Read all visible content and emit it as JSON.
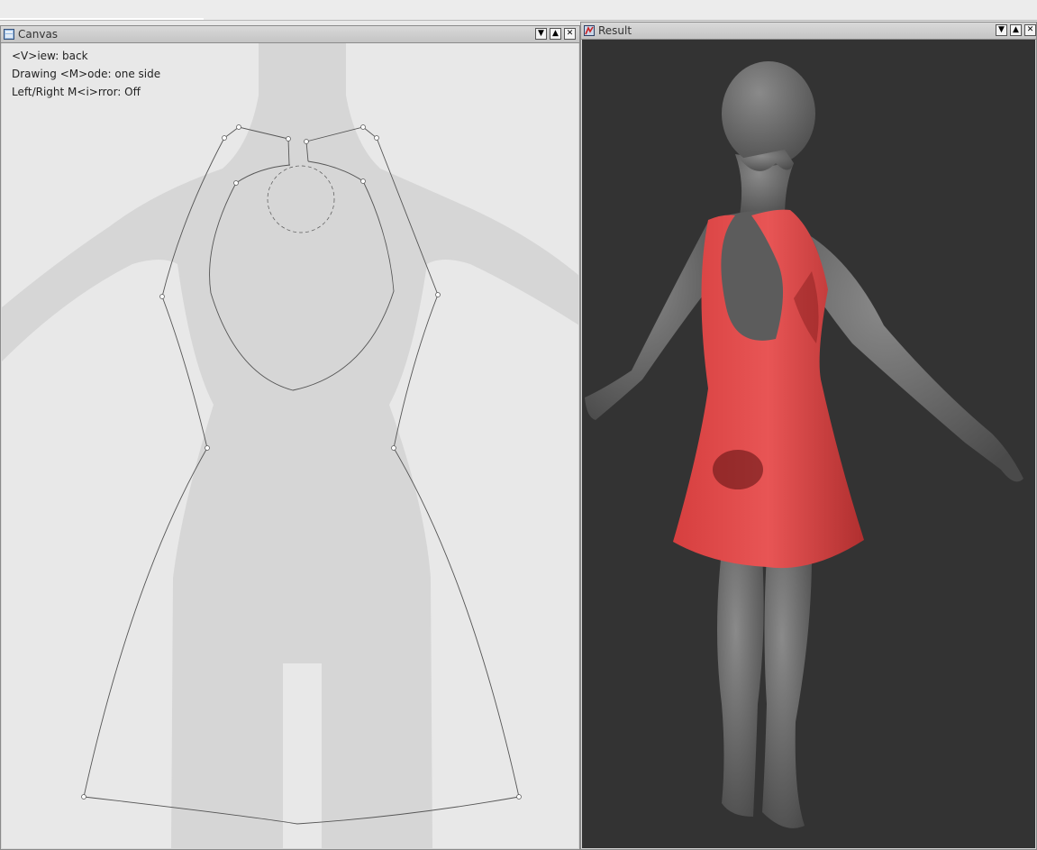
{
  "canvas_window": {
    "title": "Canvas",
    "icon": "canvas-window-icon",
    "buttons": [
      "minimize",
      "maximize",
      "close"
    ],
    "overlay": {
      "view": "<V>iew: back",
      "drawing_mode": "Drawing <M>ode: one side",
      "mirror": "Left/Right M<i>rror: Off"
    }
  },
  "result_window": {
    "title": "Result",
    "icon": "result-window-icon",
    "buttons": [
      "minimize",
      "maximize",
      "close"
    ]
  },
  "button_glyphs": {
    "minimize": "▼",
    "maximize": "▲",
    "close": "✕"
  },
  "colors": {
    "canvas_background": "#e8e8e8",
    "body_silhouette": "#d6d6d6",
    "outline": "#555555",
    "result_background": "#333333",
    "mannequin": "#666666",
    "dress": "#e04a4a"
  }
}
